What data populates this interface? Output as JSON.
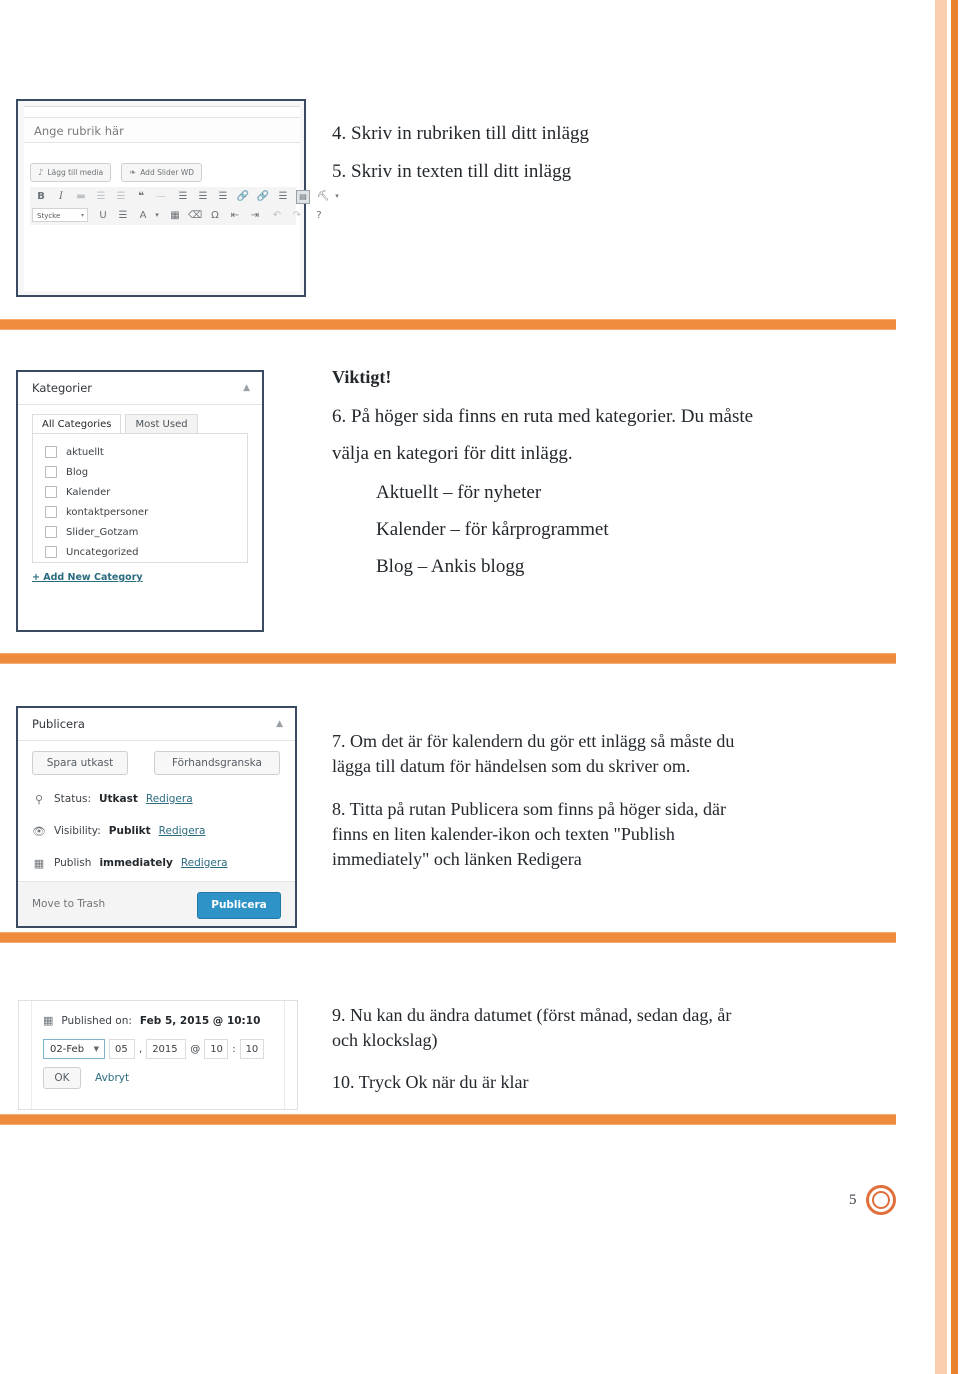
{
  "theme": {
    "accent_orange": "#ef8b3c",
    "accent_orange_light": "#fbcfae",
    "frame_navy": "#3b4a63",
    "wp_blue": "#2e93c7",
    "link_teal": "#2b6b80"
  },
  "editor": {
    "title_placeholder": "Ange rubrik här",
    "add_media_label": "Lägg till media",
    "add_media_icon": "media-icon",
    "add_slider_label": "Add Slider WD",
    "add_slider_icon": "slider-icon",
    "paragraph_select": "Stycke",
    "toolbar_row1": [
      {
        "icon": "bold-icon",
        "glyph": "B"
      },
      {
        "icon": "italic-icon",
        "glyph": "I"
      },
      {
        "icon": "strikethrough-icon",
        "glyph": "▬"
      },
      {
        "icon": "bulleted-list-icon",
        "glyph": "☰"
      },
      {
        "icon": "numbered-list-icon",
        "glyph": "☰"
      },
      {
        "icon": "blockquote-icon",
        "glyph": "❝"
      },
      {
        "icon": "horizontal-rule-icon",
        "glyph": "—"
      },
      {
        "icon": "align-left-icon",
        "glyph": "☰"
      },
      {
        "icon": "align-center-icon",
        "glyph": "☰"
      },
      {
        "icon": "align-right-icon",
        "glyph": "☰"
      },
      {
        "icon": "insert-link-icon",
        "glyph": "🔗"
      },
      {
        "icon": "unlink-icon",
        "glyph": "🔗"
      },
      {
        "icon": "read-more-icon",
        "glyph": "☰"
      },
      {
        "icon": "toggle-toolbar-icon",
        "glyph": "▤"
      },
      {
        "icon": "accessibility-icon",
        "glyph": "⛏"
      },
      {
        "icon": "more-caret-icon",
        "glyph": "▾"
      }
    ],
    "toolbar_row2": [
      {
        "icon": "underline-icon",
        "glyph": "U"
      },
      {
        "icon": "justify-icon",
        "glyph": "☰"
      },
      {
        "icon": "text-color-icon",
        "glyph": "A"
      },
      {
        "icon": "text-color-caret-icon",
        "glyph": "▾"
      },
      {
        "icon": "paste-as-text-icon",
        "glyph": "📋"
      },
      {
        "icon": "clear-formatting-icon",
        "glyph": "⌫"
      },
      {
        "icon": "special-character-icon",
        "glyph": "Ω"
      },
      {
        "icon": "outdent-icon",
        "glyph": "⇤"
      },
      {
        "icon": "indent-icon",
        "glyph": "⇥"
      },
      {
        "icon": "undo-icon",
        "glyph": "↶"
      },
      {
        "icon": "redo-icon",
        "glyph": "↷"
      },
      {
        "icon": "keyboard-help-icon",
        "glyph": "?"
      }
    ]
  },
  "categories_panel": {
    "title": "Kategorier",
    "toggle_icon": "chevron-up-icon",
    "tabs": [
      {
        "label": "All Categories",
        "active": true
      },
      {
        "label": "Most Used",
        "active": false
      }
    ],
    "items": [
      {
        "label": "aktuellt",
        "checked": false
      },
      {
        "label": "Blog",
        "checked": false
      },
      {
        "label": "Kalender",
        "checked": false
      },
      {
        "label": "kontaktpersoner",
        "checked": false
      },
      {
        "label": "Slider_Gotzam",
        "checked": false
      },
      {
        "label": "Uncategorized",
        "checked": false
      }
    ],
    "add_new_link": "+ Add New Category"
  },
  "publish_panel": {
    "title": "Publicera",
    "toggle_icon": "chevron-up-icon",
    "save_draft_label": "Spara utkast",
    "preview_label": "Förhandsgranska",
    "rows": [
      {
        "icon": "pin-icon",
        "prefix": "Status: ",
        "value": "Utkast",
        "link": "Redigera"
      },
      {
        "icon": "eye-icon",
        "prefix": "Visibility: ",
        "value": "Publikt",
        "link": "Redigera"
      },
      {
        "icon": "calendar-icon",
        "prefix": "Publish ",
        "value": "immediately",
        "link": "Redigera"
      }
    ],
    "trash_label": "Move to Trash",
    "publish_button": "Publicera"
  },
  "date_panel": {
    "calendar_icon": "calendar-icon",
    "published_on_prefix": "Published on: ",
    "published_on_value": "Feb 5, 2015 @ 10:10",
    "month_select": "02-Feb",
    "month_caret_icon": "caret-down-icon",
    "day": "05",
    "comma": ",",
    "year": "2015",
    "at": "@",
    "hour": "10",
    "colon": ":",
    "minute": "10",
    "ok_label": "OK",
    "cancel_label": "Avbryt"
  },
  "instructions": {
    "step4": "4. Skriv in rubriken till ditt inlägg",
    "step5": "5. Skriv in texten till ditt inlägg",
    "important": "Viktigt!",
    "step6_line1": "6. På höger sida finns en ruta med kategorier. Du måste",
    "step6_line2": "välja en kategori för ditt inlägg.",
    "step6_item1": "Aktuellt – för nyheter",
    "step6_item2": "Kalender – för kårprogrammet",
    "step6_item3": "Blog – Ankis blogg",
    "step7_line1": "7. Om det är för kalendern du gör ett inlägg så måste du",
    "step7_line2": "lägga till datum för händelsen som du skriver om.",
    "step8_line1": "8. Titta på rutan Publicera som finns på höger sida, där",
    "step8_line2": "finns en liten kalender-ikon och texten \"Publish",
    "step8_line3": "immediately\" och länken Redigera",
    "step9_line1": "9. Nu kan du ändra datumet (först månad, sedan dag, år",
    "step9_line2": "och klockslag)",
    "step10": "10. Tryck Ok när du är klar"
  },
  "footer": {
    "page_number": "5",
    "logo_icon": "ring-logo-icon"
  }
}
